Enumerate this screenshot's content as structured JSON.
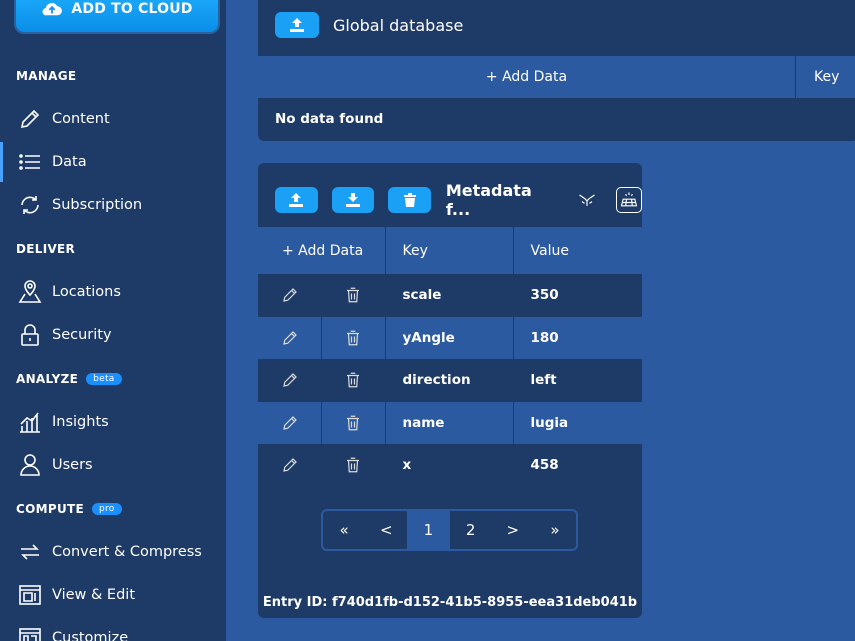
{
  "sidebar": {
    "add_to_cloud_label": "ADD TO CLOUD",
    "sections": {
      "manage": "MANAGE",
      "deliver": "DELIVER",
      "analyze": "ANALYZE",
      "analyze_badge": "beta",
      "compute": "COMPUTE",
      "compute_badge": "pro"
    },
    "items": {
      "content": "Content",
      "data": "Data",
      "subscription": "Subscription",
      "locations": "Locations",
      "security": "Security",
      "insights": "Insights",
      "users": "Users",
      "convert": "Convert & Compress",
      "view_edit": "View & Edit",
      "customize": "Customize"
    },
    "accent": "#4aa0ff"
  },
  "global_db": {
    "title": "Global database",
    "add_data": "+ Add Data",
    "key_header": "Key",
    "empty": "No data found"
  },
  "metadata": {
    "title": "Metadata f...",
    "columns": {
      "add_data": "+ Add Data",
      "key": "Key",
      "value": "Value"
    },
    "rows": [
      {
        "key": "scale",
        "value": "350"
      },
      {
        "key": "yAngle",
        "value": "180"
      },
      {
        "key": "direction",
        "value": "left"
      },
      {
        "key": "name",
        "value": "lugia"
      },
      {
        "key": "x",
        "value": "458"
      }
    ],
    "pager": {
      "first": "«",
      "prev": "<",
      "page1": "1",
      "page2": "2",
      "next": ">",
      "last": "»",
      "current": 1
    },
    "entry_id": "Entry ID: f740d1fb-d152-41b5-8955-eea31deb041b"
  }
}
